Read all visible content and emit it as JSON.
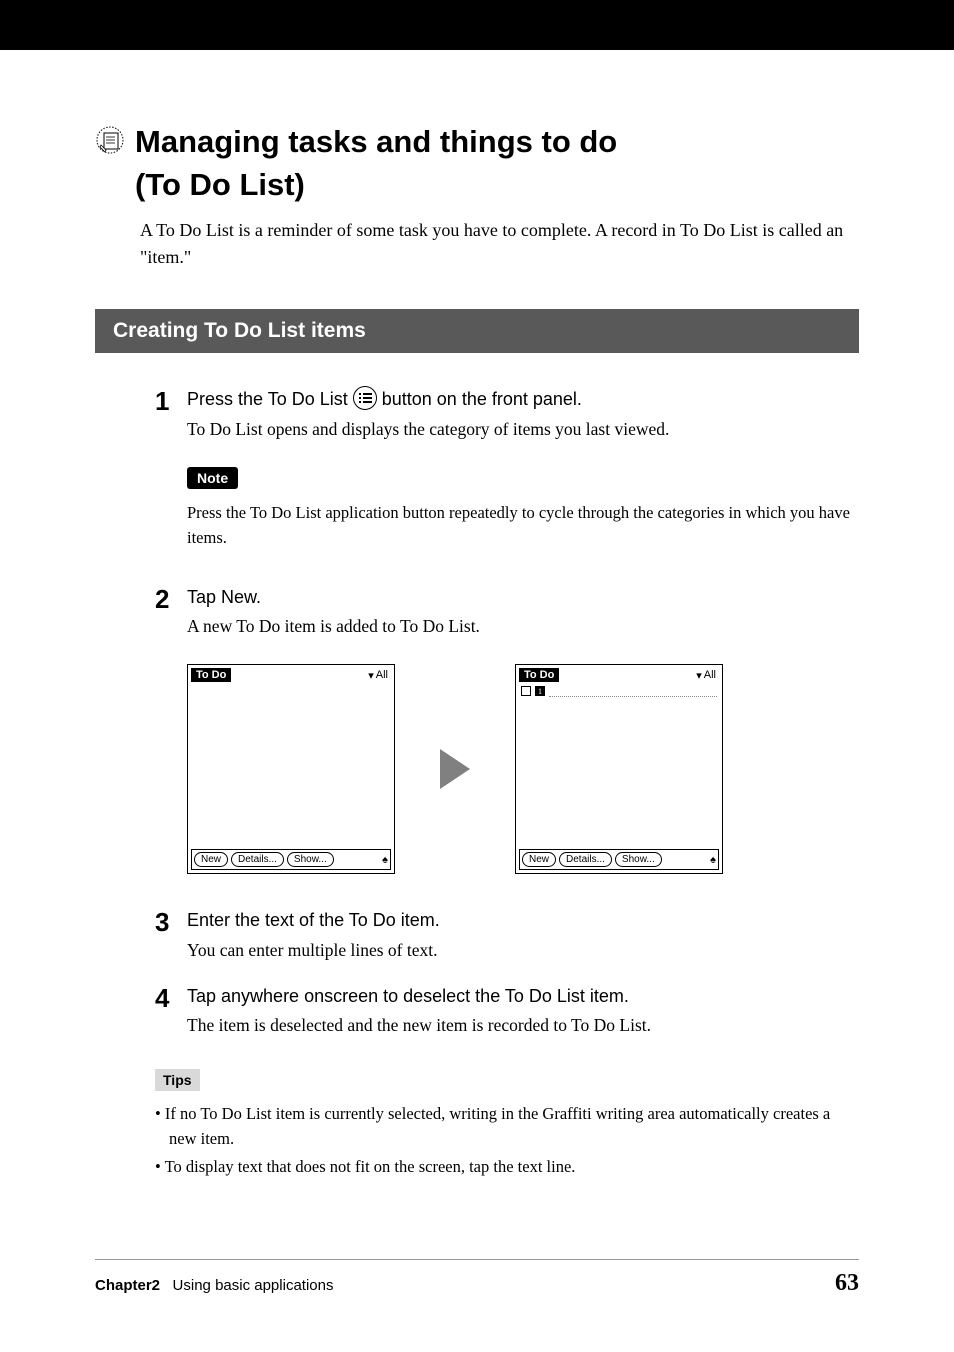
{
  "title": {
    "line1": "Managing tasks and things to do",
    "line2": "(To Do List)"
  },
  "intro": "A To Do List is a reminder of some task you have to complete. A record in To Do List is called an \"item.\"",
  "section_heading": "Creating To Do List items",
  "steps": {
    "s1": {
      "num": "1",
      "heading_pre": "Press the To Do List ",
      "heading_post": " button on the front panel.",
      "body": "To Do List opens and displays the category of items you last viewed."
    },
    "s2": {
      "num": "2",
      "heading": "Tap New.",
      "body": "A new To Do item is added to To Do List."
    },
    "s3": {
      "num": "3",
      "heading": "Enter the text of the To Do item.",
      "body": "You can enter multiple lines of text."
    },
    "s4": {
      "num": "4",
      "heading": "Tap anywhere onscreen to deselect the To Do List item.",
      "body": "The item is deselected and the new item is recorded to To Do List."
    }
  },
  "note": {
    "label": "Note",
    "text": "Press the To Do List application button repeatedly to cycle through the categories in which you have items."
  },
  "palm": {
    "title": "To Do",
    "category": "All",
    "btn_new": "New",
    "btn_details": "Details...",
    "btn_show": "Show...",
    "priority": "1"
  },
  "tips": {
    "label": "Tips",
    "items": [
      "If no To Do List item is currently selected, writing in the Graffiti writing area automatically creates a new item.",
      "To display text that does not fit on the screen, tap the text line."
    ]
  },
  "footer": {
    "chapter_label": "Chapter2",
    "chapter_title": "Using basic applications",
    "page": "63"
  }
}
